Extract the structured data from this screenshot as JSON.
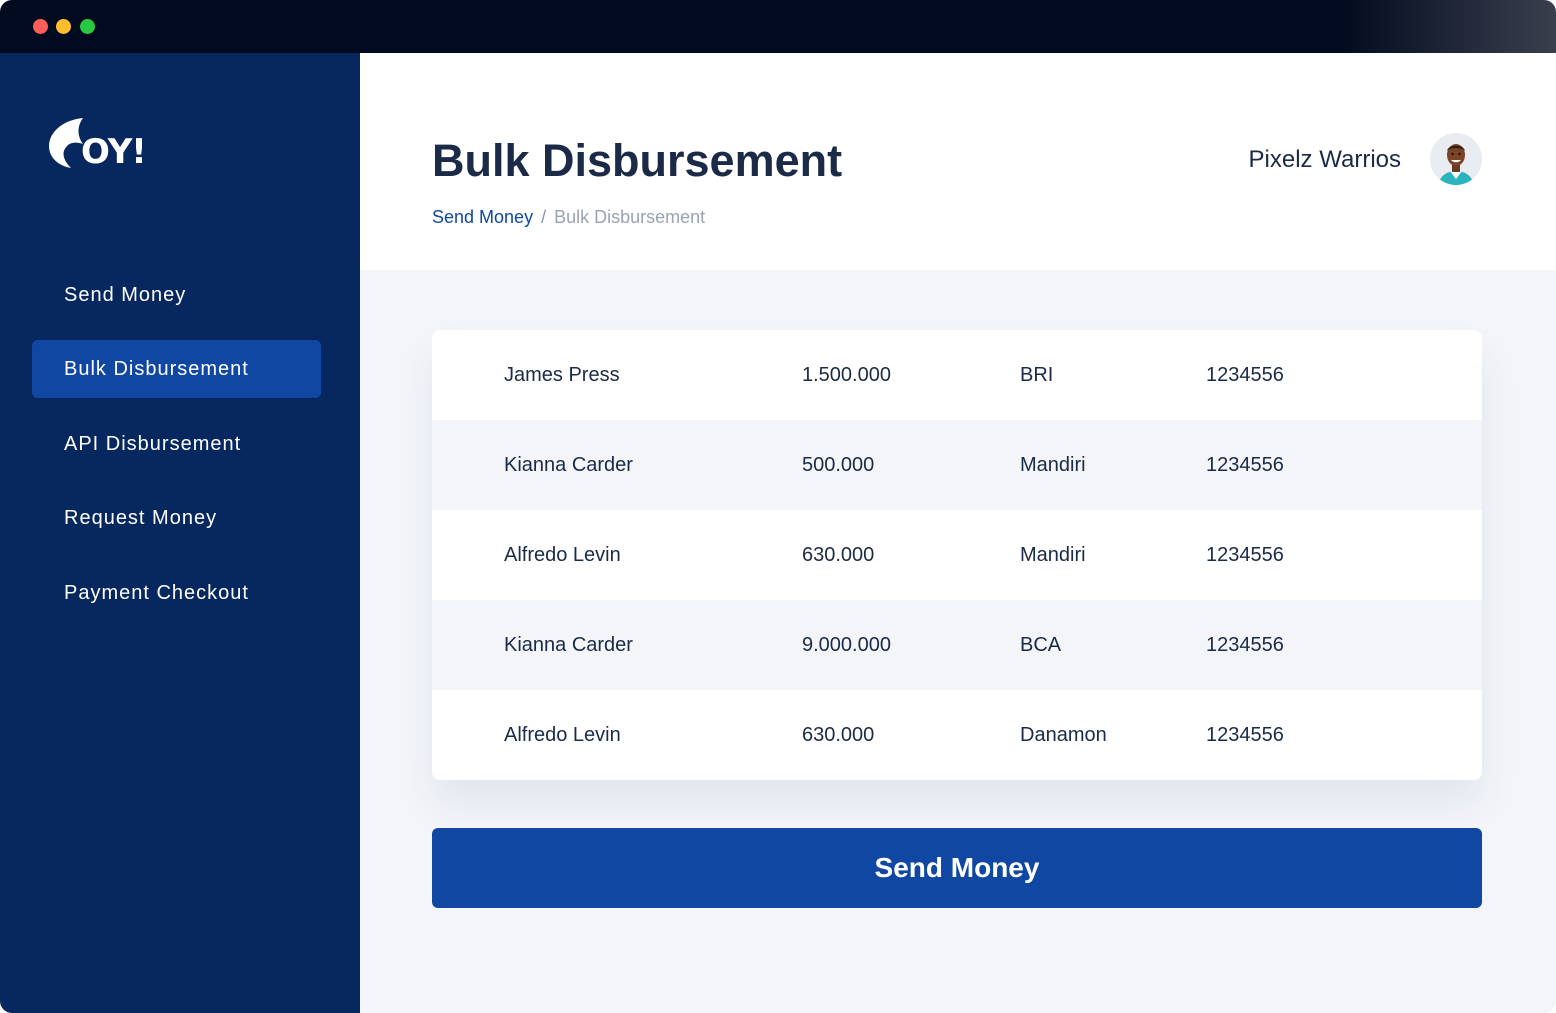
{
  "window": {
    "controls": [
      "close",
      "minimize",
      "maximize"
    ]
  },
  "logo": {
    "text": "OY!"
  },
  "sidebar": {
    "items": [
      {
        "label": "Send Money",
        "active": false
      },
      {
        "label": "Bulk Disbursement",
        "active": true
      },
      {
        "label": "API Disbursement",
        "active": false
      },
      {
        "label": "Request Money",
        "active": false
      },
      {
        "label": "Payment Checkout",
        "active": false
      }
    ]
  },
  "header": {
    "title": "Bulk Disbursement",
    "breadcrumb": {
      "link": "Send Money",
      "separator": "/",
      "current": "Bulk Disbursement"
    },
    "user_name": "Pixelz Warrios"
  },
  "table": {
    "rows": [
      {
        "name": "James Press",
        "amount": "1.500.000",
        "bank": "BRI",
        "account": "1234556"
      },
      {
        "name": "Kianna Carder",
        "amount": "500.000",
        "bank": "Mandiri",
        "account": "1234556"
      },
      {
        "name": "Alfredo Levin",
        "amount": "630.000",
        "bank": "Mandiri",
        "account": "1234556"
      },
      {
        "name": "Kianna Carder",
        "amount": "9.000.000",
        "bank": "BCA",
        "account": "1234556"
      },
      {
        "name": "Alfredo Levin",
        "amount": "630.000",
        "bank": "Danamon",
        "account": "1234556"
      }
    ]
  },
  "actions": {
    "send_label": "Send Money"
  },
  "colors": {
    "sidebar": "#07285e",
    "accent": "#0f47a3",
    "title_text": "#1b2a47",
    "content_bg": "#f3f5f9"
  },
  "icons": {
    "avatar": "user-avatar"
  }
}
